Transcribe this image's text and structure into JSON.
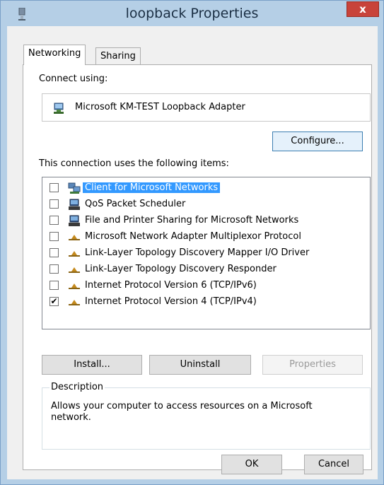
{
  "window": {
    "title": "loopback Properties",
    "close_label": "x"
  },
  "tabs": [
    {
      "label": "Networking",
      "active": true
    },
    {
      "label": "Sharing",
      "active": false
    }
  ],
  "connect_using": {
    "label": "Connect using:",
    "adapter": "Microsoft KM-TEST Loopback Adapter",
    "configure_label": "Configure..."
  },
  "items_section": {
    "label": "This connection uses the following items:",
    "items": [
      {
        "label": "Client for Microsoft Networks",
        "checked": false,
        "selected": true,
        "icon": "network-client-icon"
      },
      {
        "label": "QoS Packet Scheduler",
        "checked": false,
        "selected": false,
        "icon": "computer-service-icon"
      },
      {
        "label": "File and Printer Sharing for Microsoft Networks",
        "checked": false,
        "selected": false,
        "icon": "computer-service-icon"
      },
      {
        "label": "Microsoft Network Adapter Multiplexor Protocol",
        "checked": false,
        "selected": false,
        "icon": "protocol-icon"
      },
      {
        "label": "Link-Layer Topology Discovery Mapper I/O Driver",
        "checked": false,
        "selected": false,
        "icon": "protocol-icon"
      },
      {
        "label": "Link-Layer Topology Discovery Responder",
        "checked": false,
        "selected": false,
        "icon": "protocol-icon"
      },
      {
        "label": "Internet Protocol Version 6 (TCP/IPv6)",
        "checked": false,
        "selected": false,
        "icon": "protocol-icon"
      },
      {
        "label": "Internet Protocol Version 4 (TCP/IPv4)",
        "checked": true,
        "selected": false,
        "icon": "protocol-icon"
      }
    ]
  },
  "buttons": {
    "install": "Install...",
    "uninstall": "Uninstall",
    "properties": "Properties"
  },
  "description": {
    "legend": "Description",
    "text": "Allows your computer to access resources on a Microsoft network."
  },
  "footer": {
    "ok": "OK",
    "cancel": "Cancel"
  }
}
